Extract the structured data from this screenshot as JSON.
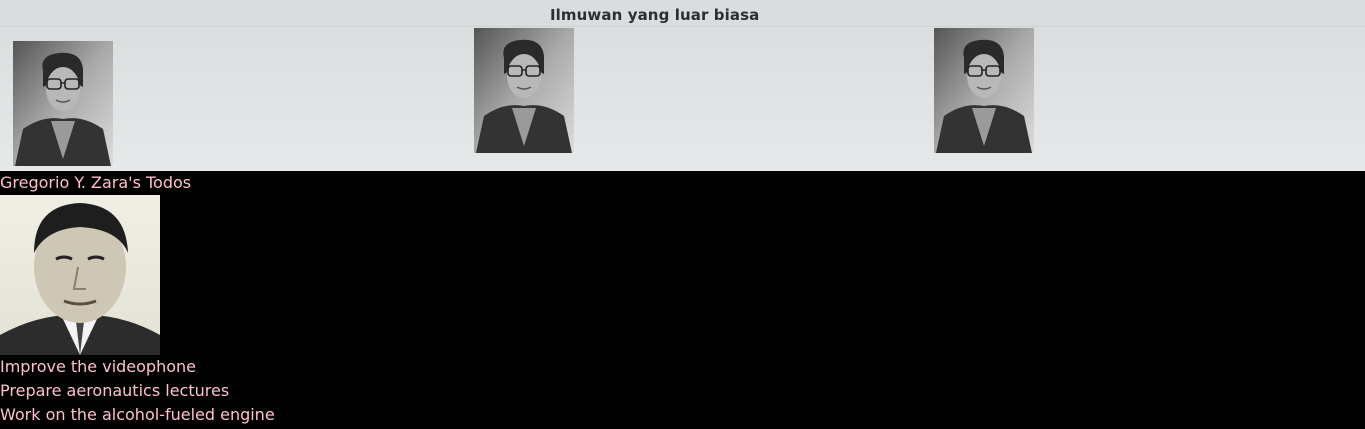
{
  "gallery": {
    "title": "Ilmuwan yang luar biasa",
    "images": [
      {
        "subject": "scientist-portrait-icon"
      },
      {
        "subject": "scientist-portrait-icon"
      },
      {
        "subject": "scientist-portrait-icon"
      }
    ]
  },
  "todos": {
    "heading": "Gregorio Y. Zara's Todos",
    "avatar": {
      "subject": "scientist-portrait-icon"
    },
    "items": [
      "Improve the videophone",
      "Prepare aeronautics lectures",
      "Work on the alcohol-fueled engine"
    ]
  },
  "colors": {
    "todo_text": "#ffc0cb",
    "page_bg": "#000000",
    "gallery_bg": "#dde1e2"
  }
}
